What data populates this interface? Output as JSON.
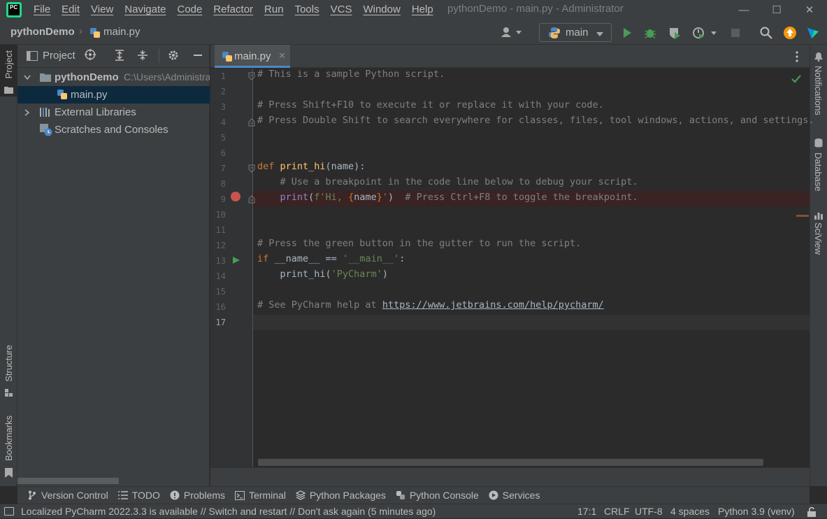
{
  "title_bar": {
    "logo_text": "PC",
    "menu": [
      "File",
      "Edit",
      "View",
      "Navigate",
      "Code",
      "Refactor",
      "Run",
      "Tools",
      "VCS",
      "Window",
      "Help"
    ],
    "window_title": "pythonDemo - main.py - Administrator",
    "controls": {
      "minimize": "—",
      "maximize": "☐",
      "close": "✕"
    }
  },
  "navbar": {
    "breadcrumb_project": "pythonDemo",
    "breadcrumb_file": "main.py",
    "run_config": "main"
  },
  "left_strip": {
    "project": "Project",
    "structure": "Structure",
    "bookmarks": "Bookmarks"
  },
  "right_strip": {
    "notifications": "Notifications",
    "database": "Database",
    "sciview": "SciView"
  },
  "project_panel": {
    "title": "Project",
    "tree": {
      "root_name": "pythonDemo",
      "root_path": "C:\\Users\\Administrator\\PycharmProjects\\pythonDemo",
      "file": "main.py",
      "external_libraries": "External Libraries",
      "scratches": "Scratches and Consoles"
    }
  },
  "editor": {
    "tab_label": "main.py",
    "line_numbers": [
      "1",
      "2",
      "3",
      "4",
      "5",
      "6",
      "7",
      "8",
      "9",
      "10",
      "11",
      "12",
      "13",
      "14",
      "15",
      "16",
      "17"
    ],
    "code": {
      "l1": "# This is a sample Python script.",
      "l3": "# Press Shift+F10 to execute it or replace it with your code.",
      "l4": "# Press Double Shift to search everywhere for classes, files, tool windows, actions, and settings.",
      "l7_kw": "def ",
      "l7_fn": "print_hi",
      "l7_rest": "(name):",
      "l8": "    # Use a breakpoint in the code line below to debug your script.",
      "l9_indent": "    ",
      "l9_print": "print",
      "l9_open": "(",
      "l9_str1": "f'Hi, ",
      "l9_brace_open": "{",
      "l9_name": "name",
      "l9_brace_close": "}",
      "l9_str2": "'",
      "l9_close": ")",
      "l9_comment": "  # Press Ctrl+F8 to toggle the breakpoint.",
      "l12": "# Press the green button in the gutter to run the script.",
      "l13_kw": "if ",
      "l13_mid": "__name__ == ",
      "l13_str": "'__main__'",
      "l13_end": ":",
      "l14_pre": "    print_hi(",
      "l14_str": "'PyCharm'",
      "l14_end": ")",
      "l16_cmt": "# See PyCharm help at ",
      "l16_link": "https://www.jetbrains.com/help/pycharm/"
    }
  },
  "bottom_tools": [
    "Version Control",
    "TODO",
    "Problems",
    "Terminal",
    "Python Packages",
    "Python Console",
    "Services"
  ],
  "status_bar": {
    "message": "Localized PyCharm 2022.3.3 is available // Switch and restart // Don't ask again (5 minutes ago)",
    "position": "17:1",
    "line_sep": "CRLF",
    "encoding": "UTF-8",
    "indent": "4 spaces",
    "interpreter": "Python 3.9 (venv)"
  },
  "colors": {
    "accent": "#4a88c7",
    "run_green": "#499c54",
    "breakpoint_red": "#c75450",
    "panel_bg": "#3c3f41",
    "editor_bg": "#2b2b2b"
  }
}
